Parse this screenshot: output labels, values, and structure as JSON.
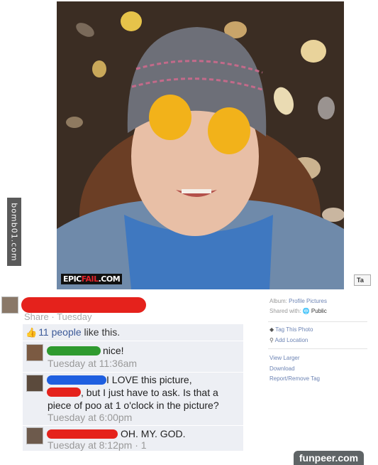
{
  "watermark_side": "bomb01.com",
  "photo": {
    "logo_epic": "EPIC",
    "logo_fail": "FAIL",
    "logo_tld": ".COM",
    "tag_button": "Ta"
  },
  "post": {
    "share_label": "Share",
    "dot": "·",
    "posted": "Tuesday"
  },
  "likes": {
    "count_text": "11 people",
    "rest": " like this."
  },
  "comments": [
    {
      "text": "nice!",
      "time": "Tuesday at 11:36am"
    },
    {
      "text_line1": "I LOVE this picture,",
      "text_line2": ", but I just have to ask. Is that a",
      "text_line3": "piece of poo at 1 o'clock in the picture?",
      "time": "Tuesday at 6:00pm"
    },
    {
      "text": "OH. MY. GOD.",
      "time": "Tuesday at 8:12pm · 1"
    }
  ],
  "sidebar": {
    "album_label": "Album:",
    "album_value": "Profile Pictures",
    "shared_label": "Shared with:",
    "shared_value": "Public",
    "tag_photo": "Tag This Photo",
    "add_location": "Add Location",
    "view_larger": "View Larger",
    "download": "Download",
    "report": "Report/Remove Tag"
  },
  "watermark_bottom": "funpeer.com",
  "colors": {
    "link": "#3b5998",
    "panel": "#edeff4",
    "redact_red": "#e5221c",
    "redact_green": "#2f9a2f",
    "redact_blue": "#1f5fe0"
  }
}
